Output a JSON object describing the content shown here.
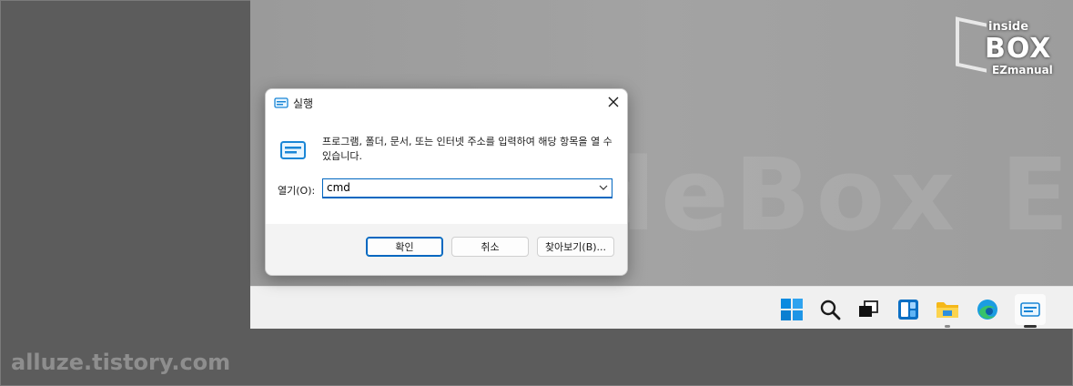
{
  "dialog": {
    "title": "실행",
    "description": "프로그램, 폴더, 문서, 또는 인터넷 주소를 입력하여 해당 항목을 열 수 있습니다.",
    "open_label": "열기(O):",
    "input_value": "cmd",
    "buttons": {
      "ok": "확인",
      "cancel": "취소",
      "browse": "찾아보기(B)..."
    }
  },
  "taskbar": {
    "items": [
      "start-icon",
      "search-icon",
      "task-view-icon",
      "widgets-icon",
      "file-explorer-icon",
      "edge-icon",
      "run-icon"
    ]
  },
  "watermarks": {
    "logo_top": "inside",
    "logo_main": "BOX",
    "logo_bottom": "EZmanual",
    "background_text": "InsideBox EZmanual",
    "site": "alluze.tistory.com"
  },
  "colors": {
    "accent": "#0067c0",
    "taskbar": "#f0f0f0",
    "dialog_bg": "#f3f3f3"
  }
}
